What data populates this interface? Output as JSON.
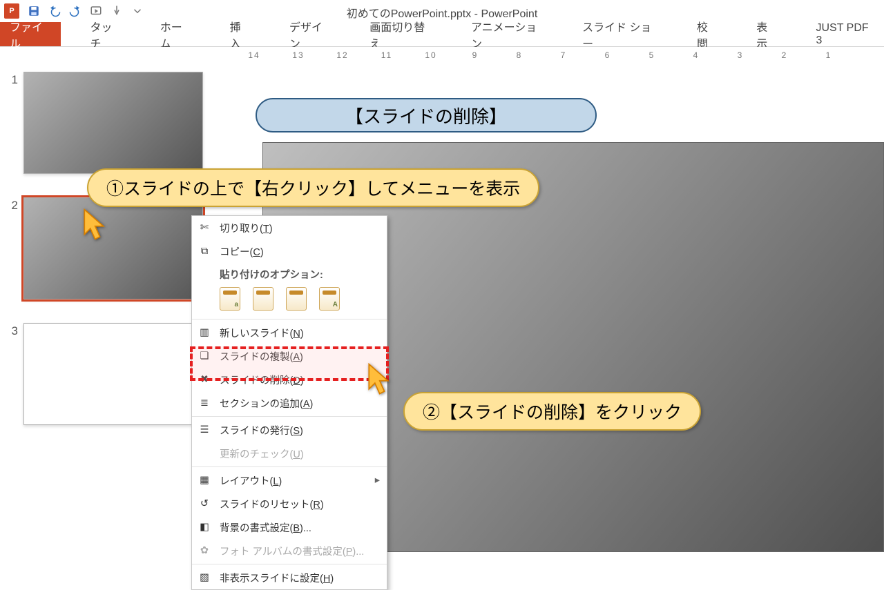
{
  "window": {
    "title": "初めてのPowerPoint.pptx - PowerPoint"
  },
  "ribbon": {
    "file": "ファイル",
    "tabs": [
      "タッチ",
      "ホーム",
      "挿入",
      "デザイン",
      "画面切り替え",
      "アニメーション",
      "スライド ショー",
      "校閲",
      "表示",
      "JUST PDF 3"
    ]
  },
  "ruler": [
    "14",
    "13",
    "12",
    "11",
    "10",
    "9",
    "8",
    "7",
    "6",
    "5",
    "4",
    "3",
    "2",
    "1"
  ],
  "thumbs": [
    {
      "num": "1",
      "kind": "gradient",
      "selected": false
    },
    {
      "num": "2",
      "kind": "gradient",
      "selected": true
    },
    {
      "num": "3",
      "kind": "blank",
      "selected": false
    }
  ],
  "context_menu": {
    "cut": {
      "label": "切り取り(",
      "key": "T",
      "suffix": ")"
    },
    "copy": {
      "label": "コピー(",
      "key": "C",
      "suffix": ")"
    },
    "paste_header": "貼り付けのオプション:",
    "new_slide": {
      "label": "新しいスライド(",
      "key": "N",
      "suffix": ")"
    },
    "duplicate": {
      "label": "スライドの複製(",
      "key": "A",
      "suffix": ")"
    },
    "delete": {
      "label": "スライドの削除(",
      "key": "D",
      "suffix": ")"
    },
    "add_section": {
      "label": "セクションの追加(",
      "key": "A",
      "suffix": ")"
    },
    "publish": {
      "label": "スライドの発行(",
      "key": "S",
      "suffix": ")"
    },
    "check_updates": {
      "label": "更新のチェック(",
      "key": "U",
      "suffix": ")"
    },
    "layout": {
      "label": "レイアウト(",
      "key": "L",
      "suffix": ")"
    },
    "reset": {
      "label": "スライドのリセット(",
      "key": "R",
      "suffix": ")"
    },
    "background": {
      "label": "背景の書式設定(",
      "key": "B",
      "suffix": ")..."
    },
    "album_format": {
      "label": "フォト アルバムの書式設定(",
      "key": "P",
      "suffix": ")..."
    },
    "hide": {
      "label": "非表示スライドに設定(",
      "key": "H",
      "suffix": ")"
    }
  },
  "annotations": {
    "title": "【スライドの削除】",
    "step1": "①スライドの上で【右クリック】してメニューを表示",
    "step2": "②【スライドの削除】をクリック"
  },
  "paste_badges": [
    "a",
    "",
    "",
    "A"
  ]
}
